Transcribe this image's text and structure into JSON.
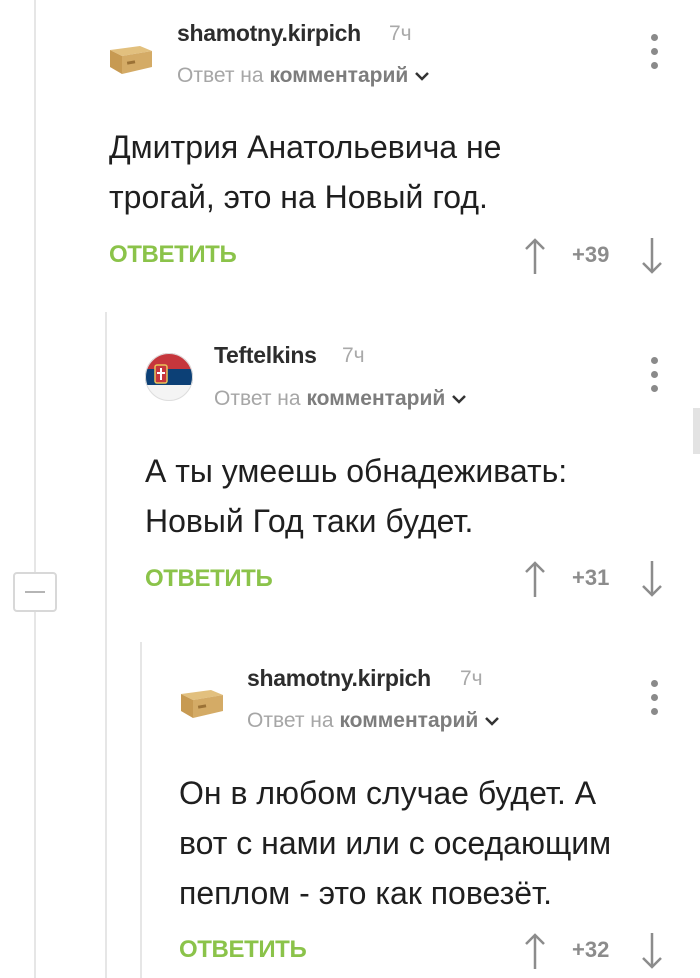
{
  "comments": [
    {
      "user": "shamotny.kirpich",
      "time": "7ч",
      "reply_prefix": "Ответ на",
      "reply_target": "комментарий",
      "text_line1": "Дмитрия Анатольевича не",
      "text_line2": "трогай, это на Новый год.",
      "reply_label": "ОТВЕТИТЬ",
      "rating": "+39"
    },
    {
      "user": "Teftelkins",
      "time": "7ч",
      "reply_prefix": "Ответ на",
      "reply_target": "комментарий",
      "text_line1": "А ты умеешь обнадеживать:",
      "text_line2": "Новый Год таки будет.",
      "reply_label": "ОТВЕТИТЬ",
      "rating": "+31"
    },
    {
      "user": "shamotny.kirpich",
      "time": "7ч",
      "reply_prefix": "Ответ на",
      "reply_target": "комментарий",
      "text_line1": "Он в любом случае будет. А",
      "text_line2": "вот с нами или с оседающим",
      "text_line3": "пеплом - это как повезёт.",
      "reply_label": "ОТВЕТИТЬ",
      "rating": "+32"
    }
  ],
  "colors": {
    "accent_green": "#8bc34a",
    "muted_gray": "#a6a6a6",
    "username": "#2d2d2d"
  },
  "icons": [
    "brick-avatar-icon",
    "serbia-flag-avatar-icon",
    "more-options-icon",
    "chevron-down-icon",
    "upvote-arrow-icon",
    "downvote-arrow-icon",
    "collapse-minus-icon"
  ]
}
